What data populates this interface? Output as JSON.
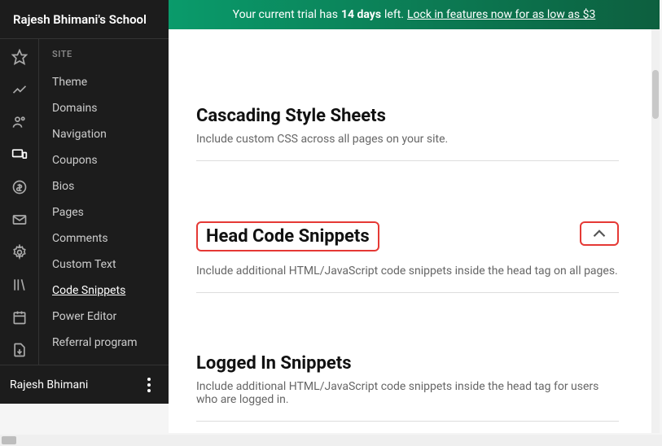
{
  "header": {
    "title": "Rajesh Bhimani's School"
  },
  "trial": {
    "prefix": "Your current trial has",
    "days": "14 days",
    "suffix": "left.",
    "cta": "Lock in features now for as low as $3"
  },
  "sidebar": {
    "heading": "SITE",
    "items": [
      {
        "label": "Theme"
      },
      {
        "label": "Domains"
      },
      {
        "label": "Navigation"
      },
      {
        "label": "Coupons"
      },
      {
        "label": "Bios"
      },
      {
        "label": "Pages"
      },
      {
        "label": "Comments"
      },
      {
        "label": "Custom Text"
      },
      {
        "label": "Code Snippets",
        "active": true
      },
      {
        "label": "Power Editor"
      },
      {
        "label": "Referral program"
      }
    ]
  },
  "footer": {
    "name": "Rajesh Bhimani"
  },
  "sections": [
    {
      "title": "Cascading Style Sheets",
      "desc": "Include custom CSS across all pages on your site."
    },
    {
      "title": "Head Code Snippets",
      "desc": "Include additional HTML/JavaScript code snippets inside the head tag on all pages.",
      "highlighted": true
    },
    {
      "title": "Logged In Snippets",
      "desc": "Include additional HTML/JavaScript code snippets inside the head tag for users who are logged in."
    }
  ]
}
